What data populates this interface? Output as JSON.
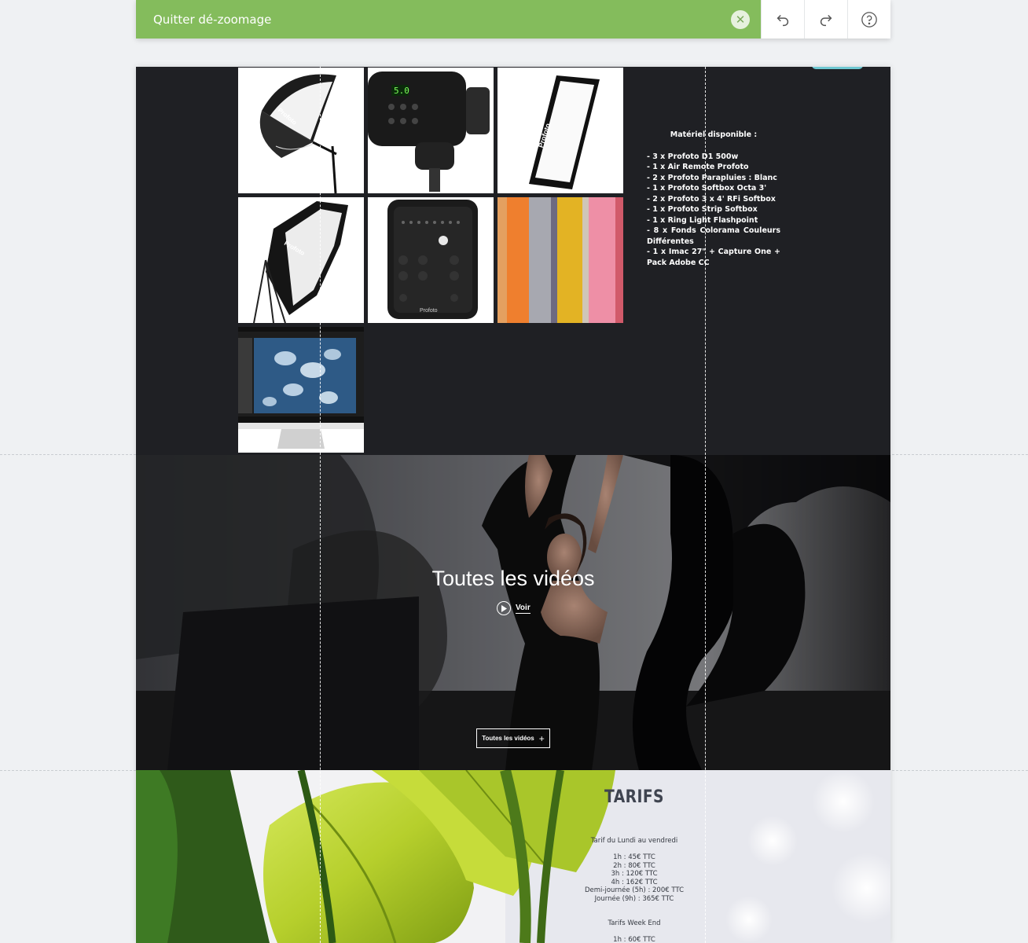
{
  "toolbar": {
    "zoom_label": "Quitter dé-zoomage",
    "close_icon": "close-icon",
    "undo_icon": "undo-icon",
    "redo_icon": "redo-icon",
    "help_icon": "help-icon"
  },
  "equipment": {
    "title": "Matériel disponible :",
    "items": [
      "- 3 x Profoto D1 500w",
      "- 1 x Air Remote Profoto",
      "- 2 x Profoto Parapluies : Blanc",
      "- 1 x Profoto Softbox Octa 3'",
      "- 2 x Profoto 3 x 4' RFi Softbox",
      "- 1 x Profoto Strip Softbox",
      "- 1 x Ring Light Flashpoint",
      "- 8 x Fonds Colorama Couleurs Différentes",
      "- 1 x Imac 27\" + Capture One + Pack Adobe CC"
    ],
    "tile_screen_text": "5.0",
    "tile_remote_brand": "Profoto"
  },
  "videos": {
    "title": "Toutes les vidéos",
    "watch_label": "Voir",
    "all_button_label": "Toutes les vidéos",
    "all_button_plus": "+"
  },
  "tarifs": {
    "title": "TARIFS",
    "weekday_heading": "Tarif du Lundi au vendredi",
    "weekday_rates": [
      "1h : 45€ TTC",
      "2h : 80€ TTC",
      "3h : 120€ TTC",
      "4h : 162€ TTC",
      "Demi-journée (5h) : 200€ TTC",
      "Journée (9h) : 365€ TTC"
    ],
    "weekend_heading": "Tarifs Week End",
    "weekend_rates": [
      "1h : 60€ TTC"
    ]
  }
}
